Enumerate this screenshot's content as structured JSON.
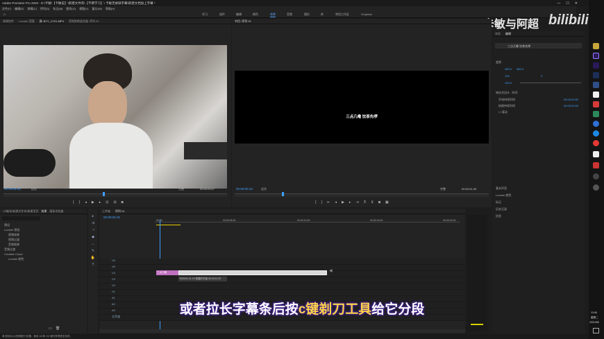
{
  "window": {
    "title": "Adobe Premiere Pro 2020 - D:\\卡敏\\【卡敏说】\\新建文件夹\\【不费学习】\\ 卡敏无故缺字幕\\新建文档加上字幕 *",
    "min": "—",
    "max": "☐",
    "close": "✕"
  },
  "menu": [
    "文件(F)",
    "编辑(E)",
    "剪辑(C)",
    "序列(S)",
    "标记(M)",
    "图形(G)",
    "视图(V)",
    "窗口(W)",
    "帮助(H)"
  ],
  "workspaces": [
    "学习",
    "组件",
    "编辑",
    "颜色",
    "效果",
    "音频",
    "图形",
    "库",
    "常用工作区",
    "Graphics"
  ],
  "active_workspace": "效果",
  "watermark": {
    "text": "卡敏与阿超",
    "logo": "bilibili"
  },
  "source": {
    "tabs": [
      "效果控件",
      "Lumetri 范围",
      "源: BYY_C701.MP4",
      "音频剪辑混合器: 序列 01"
    ],
    "timecode_in": "00:00:09:49",
    "fit": "适合",
    "ratio": "完整",
    "timecode_out": "00:00:03:27"
  },
  "program": {
    "tab": "节目: 序列 01",
    "caption": "三点几嘞 饮茶先啰",
    "timecode_in": "00:00:00:19",
    "fit": "适合",
    "ratio": "完整",
    "timecode_out": "00:00:01:39"
  },
  "essential_graphics": {
    "tabs": [
      "浏览",
      "编辑"
    ],
    "layer": "三点几嘞 饮茶先啰",
    "section_transform": "变换",
    "vals": [
      "480.0",
      "980.0",
      "100",
      "0",
      "100.0"
    ],
    "section_responsive": "响应式设计 - 时间",
    "intro": "开场持续时间",
    "intro_val": "00:00:00:00",
    "outro": "结尾持续时间",
    "outro_val": "00:00:00:00",
    "roll": "滚动",
    "lower_items": [
      "基本声音",
      "Lumetri 颜色",
      "标记",
      "历史记录",
      "信息"
    ]
  },
  "project": {
    "tabs": [
      "\\卡敏说\\新建文件夹\\新建项目",
      "效果",
      "媒体浏览器"
    ],
    "search_placeholder": "",
    "tree": [
      "预设",
      "Lumetri 预设",
      "视频效果",
      "视频过渡",
      "音频效果",
      "音频过渡",
      "Creative Cloud",
      "Lumetri 颜色"
    ],
    "status": "单击拖动以对剪辑进行设置。使用 Alt 和 Ctrl 键可获得更多选项。"
  },
  "timeline": {
    "tabs": [
      "上传者",
      "序列 01"
    ],
    "timecode": "00:00:00:19",
    "ruler": [
      "00:00",
      "00:00:05:00",
      "00:00:10:00",
      "00:00:15:00",
      "00:00:20:00"
    ],
    "tracks": [
      "V6",
      "V5",
      "V4",
      "V3",
      "V2",
      "V1",
      "A1",
      "A2",
      "A3",
      "主声道"
    ],
    "clip_label": "三点几嘞",
    "clip_text": "YB2024-01-19 修建的字幕 00:00:11:22"
  },
  "subtitle": {
    "pre": "或者拉长字幕条后按",
    "hl": "c键剃刀工具",
    "post": "给它分段"
  },
  "taskbar": {
    "time": "13:46",
    "day": "星期二",
    "date": "2021/6/8"
  }
}
